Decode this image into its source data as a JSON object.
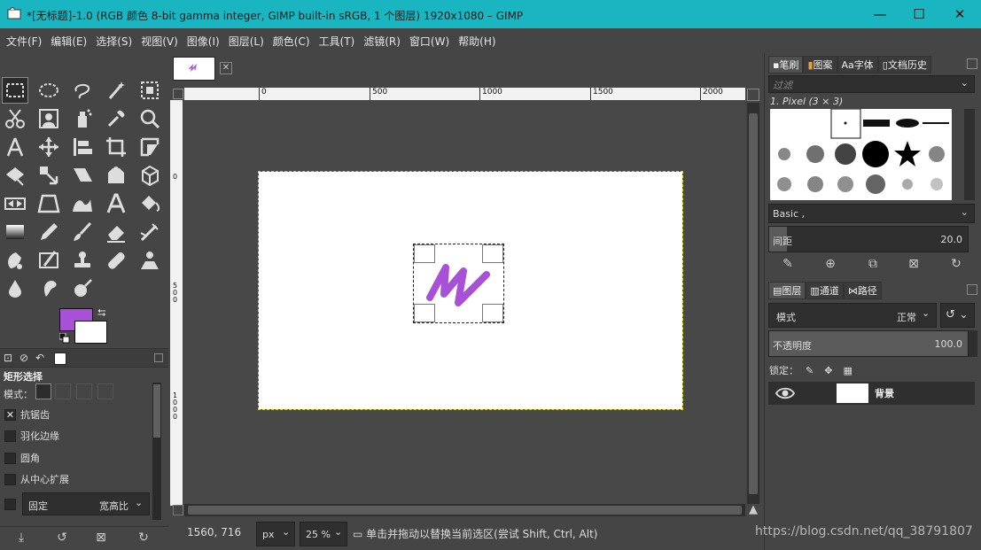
{
  "window": {
    "title": "*[无标题]-1.0 (RGB 颜色 8-bit gamma integer, GIMP built-in sRGB, 1 个图层) 1920x1080 – GIMP",
    "minimize": "—",
    "maximize": "☐",
    "close": "✕"
  },
  "menu": [
    "文件(F)",
    "编辑(E)",
    "选择(S)",
    "视图(V)",
    "图像(I)",
    "图层(L)",
    "颜色(C)",
    "工具(T)",
    "滤镜(R)",
    "窗口(W)",
    "帮助(H)"
  ],
  "colors": {
    "foreground": "#a851d6",
    "background": "#ffffff",
    "titlebar": "#19b6c2"
  },
  "tool_options": {
    "title": "矩形选择",
    "mode_label": "模式：",
    "options": [
      {
        "label": "抗锯齿",
        "checked": true
      },
      {
        "label": "羽化边缘",
        "checked": false
      },
      {
        "label": "圆角",
        "checked": false
      },
      {
        "label": "从中心扩展",
        "checked": false
      }
    ],
    "fixed_label": "固定",
    "fixed_value": "宽高比"
  },
  "ruler": {
    "h_ticks": [
      "0",
      "500",
      "1000",
      "1500",
      "2000"
    ],
    "v_ticks": [
      "0",
      "500",
      "1000"
    ]
  },
  "status": {
    "coords": "1560, 716",
    "unit": "px",
    "zoom": "25 %",
    "message": "单击并拖动以替换当前选区(尝试 Shift, Ctrl, Alt)"
  },
  "dock": {
    "brush_tabs": [
      "笔刷",
      "图案",
      "字体",
      "文档历史"
    ],
    "filter_placeholder": "过滤",
    "brush_name": "1. Pixel (3 × 3)",
    "brush_set": "Basic ,",
    "spacing_label": "间距",
    "spacing_value": "20.0",
    "layer_tabs": [
      "图层",
      "通道",
      "路径"
    ],
    "mode_label": "模式",
    "mode_value": "正常",
    "opacity_label": "不透明度",
    "opacity_value": "100.0",
    "lock_label": "锁定：",
    "layer_name": "背景"
  },
  "watermark": "https://blog.csdn.net/qq_38791807"
}
